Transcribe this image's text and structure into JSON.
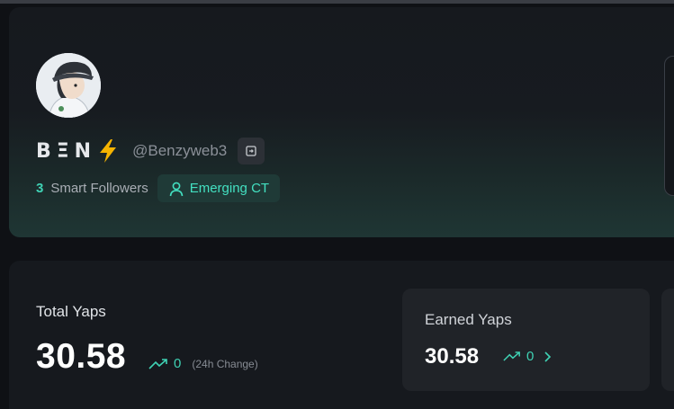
{
  "profile": {
    "display_name": "BΞN",
    "name_icon": "lightning-bolt-icon",
    "handle": "@Benzyweb3",
    "handle_button_icon": "login-icon",
    "smart_followers_count": "3",
    "smart_followers_label": "Smart Followers",
    "badge_label": "Emerging CT",
    "badge_icon": "user-icon"
  },
  "stats": {
    "total_label": "Total Yaps",
    "total_value": "30.58",
    "total_change": "0",
    "total_change_note": "(24h Change)",
    "earned_label": "Earned Yaps",
    "earned_value": "30.58",
    "earned_change": "0",
    "trend_icon": "trending-up-icon",
    "earned_arrow_icon": "chevron-right-icon"
  },
  "colors": {
    "accent": "#3fd2b4",
    "background": "#0f1115",
    "card": "#16191e",
    "bolt": "#f5b301"
  }
}
